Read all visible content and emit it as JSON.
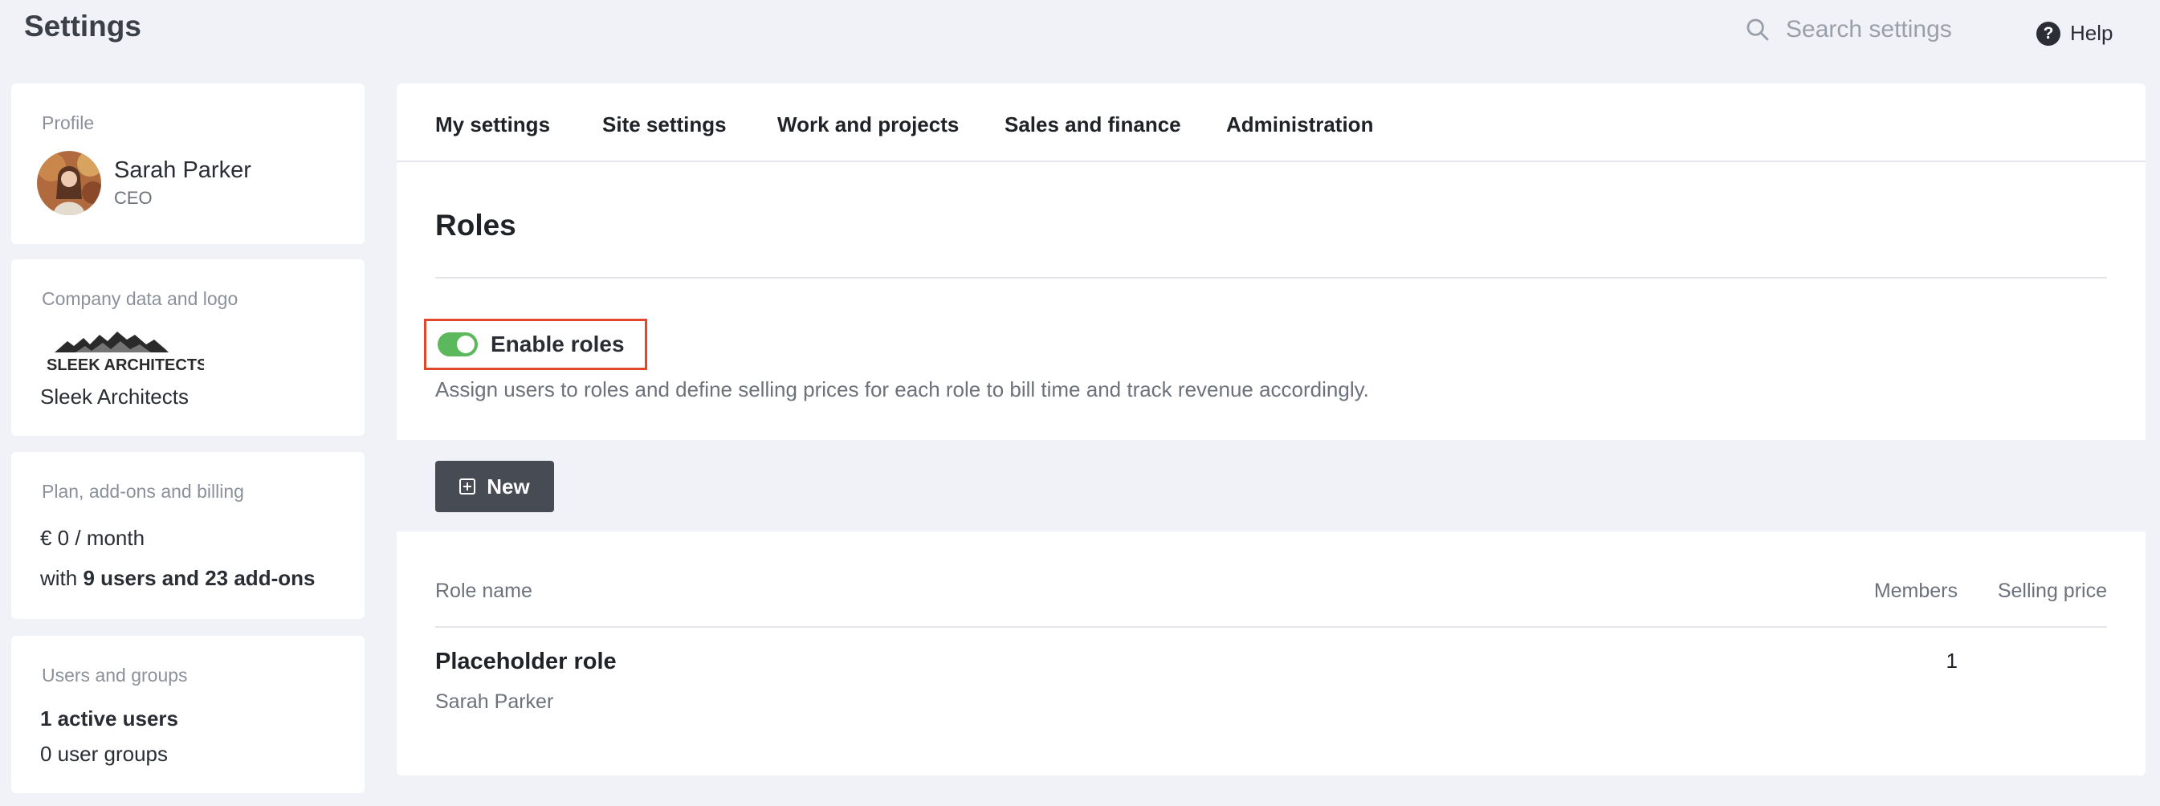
{
  "header": {
    "title": "Settings",
    "search_placeholder": "Search settings",
    "help_label": "Help"
  },
  "sidebar": {
    "profile": {
      "caption": "Profile",
      "name": "Sarah Parker",
      "title": "CEO"
    },
    "company": {
      "caption": "Company data and logo",
      "logo_text": "SLEEK ARCHITECTS",
      "name": "Sleek Architects"
    },
    "plan": {
      "caption": "Plan, add-ons and billing",
      "price": "€ 0 / month",
      "users_prefix": "with ",
      "users_bold": "9 users and 23 add-ons"
    },
    "users": {
      "caption": "Users and groups",
      "active": "1 active users",
      "groups": "0 user groups"
    }
  },
  "tabs": [
    "My settings",
    "Site settings",
    "Work and projects",
    "Sales and finance",
    "Administration"
  ],
  "roles": {
    "title": "Roles",
    "toggle_label": "Enable roles",
    "toggle_on": true,
    "description": "Assign users to roles and define selling prices for each role to bill time and track revenue accordingly.",
    "new_button": "New",
    "columns": {
      "role_name": "Role name",
      "members": "Members",
      "selling_price": "Selling price"
    },
    "rows": [
      {
        "name": "Placeholder role",
        "user": "Sarah Parker",
        "members": "1",
        "selling_price": ""
      }
    ]
  },
  "colors": {
    "toggle_on": "#5cb85c",
    "highlight": "#e0472b",
    "button": "#474b53",
    "background": "#f1f2f7"
  }
}
